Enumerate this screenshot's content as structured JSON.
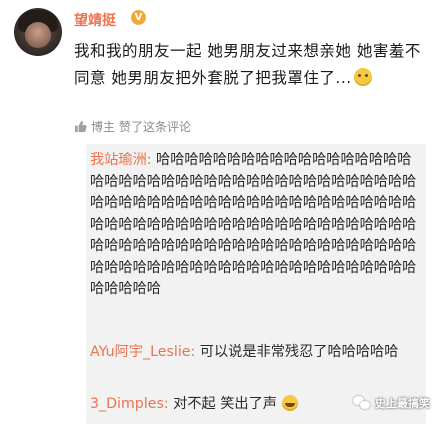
{
  "post": {
    "username": "望靖挺",
    "badge": "V",
    "text": "我和我的朋友一起 她男朋友过来想亲她 她害羞不同意 她男朋友把外套脱了把我罩住了...",
    "liked_by": "博主",
    "liked_text": "赞了这条评论"
  },
  "comments": [
    {
      "name": "我站瑜洲:",
      "text": " 哈哈哈哈哈哈哈哈哈哈哈哈哈哈哈哈哈哈哈哈哈哈哈哈哈哈哈哈哈哈哈哈哈哈哈哈哈哈哈哈哈哈哈哈哈哈哈哈哈哈哈哈哈哈哈哈哈哈哈哈哈哈哈哈哈哈哈哈哈哈哈哈哈哈哈哈哈哈哈哈哈哈哈哈哈哈哈哈哈哈哈哈哈哈哈哈哈哈哈哈哈哈哈哈哈哈哈哈哈哈哈哈哈哈哈哈哈哈哈哈哈哈哈哈哈哈哈哈哈哈哈哈哈哈哈哈哈哈"
    },
    {
      "name": "AYu阿宇_Leslie:",
      "text": " 可以说是非常残忍了哈哈哈哈哈"
    },
    {
      "name": "3_Dimples:",
      "text": " 对不起 笑出了声"
    }
  ],
  "watermark": "史上最搞笑",
  "icons": {
    "avatar": "avatar",
    "badge": "vip-badge-icon",
    "thumb": "thumb-up-icon",
    "emoji": "awkward-smile-emoji-icon",
    "laugh": "laugh-emoji-icon",
    "wechat": "wechat-logo-icon"
  },
  "colors": {
    "name": "#eb7350",
    "comment_bg": "#f2f2f2"
  }
}
